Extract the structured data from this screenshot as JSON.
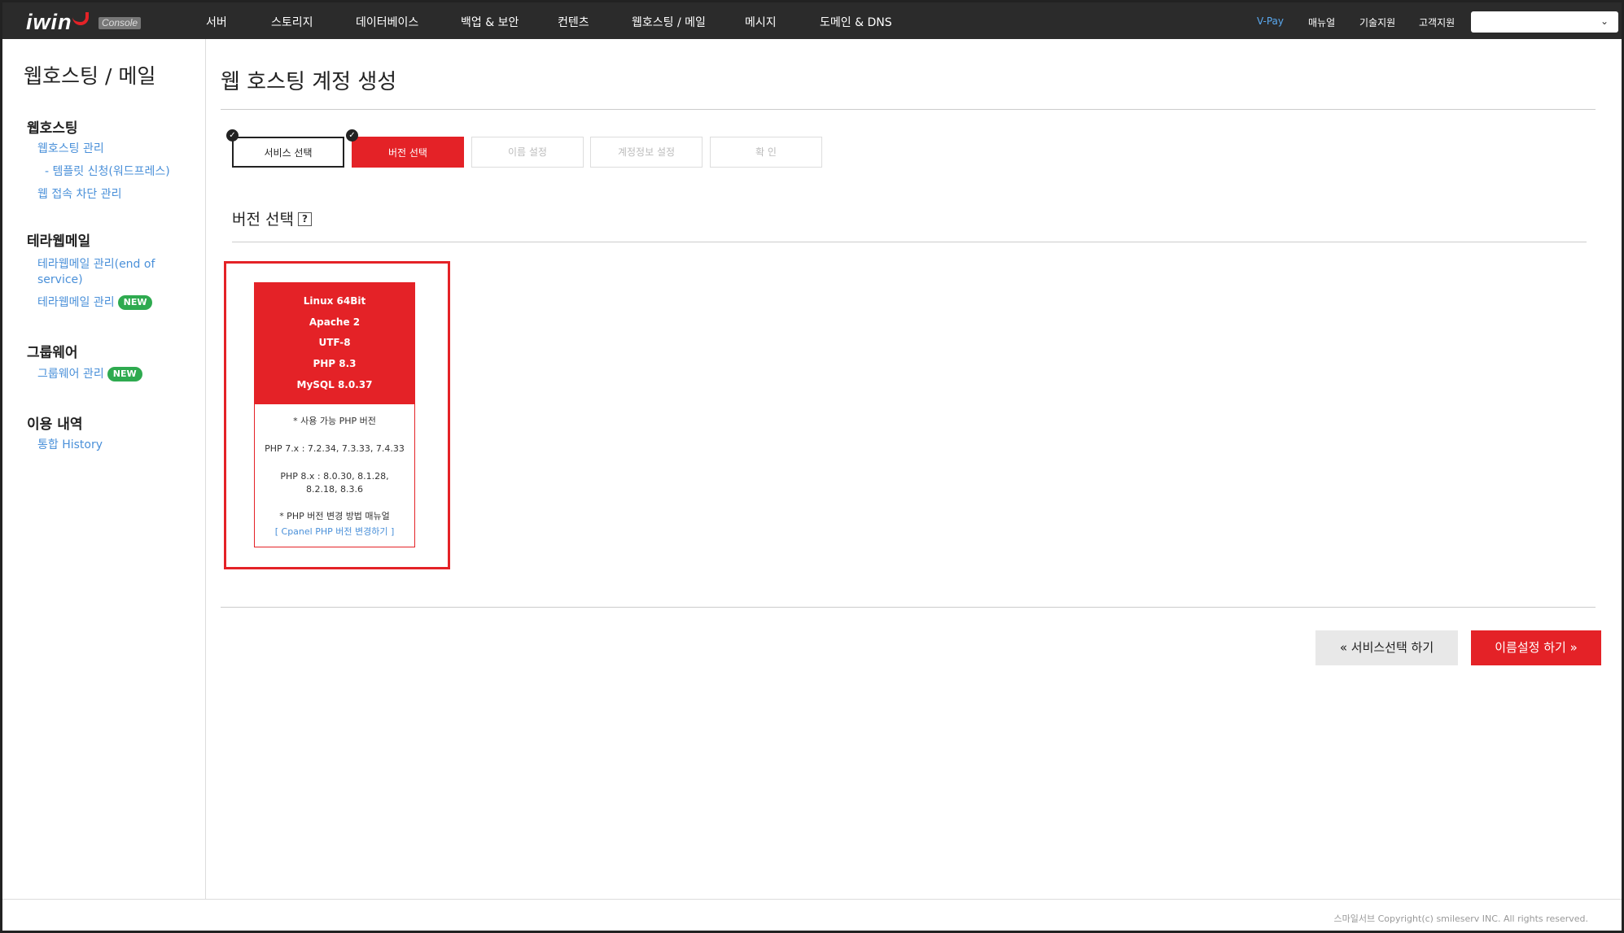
{
  "topbar": {
    "logo": "iwin",
    "console_badge": "Console",
    "nav": [
      "서버",
      "스토리지",
      "데이터베이스",
      "백업 & 보안",
      "컨텐츠",
      "웹호스팅 / 메일",
      "메시지",
      "도메인 & DNS"
    ],
    "util": [
      "V-Pay",
      "매뉴얼",
      "기술지원",
      "고객지원"
    ],
    "select_value": "",
    "chevron_icon": "chevron-down-icon"
  },
  "sidebar": {
    "title": "웹호스팅 / 메일",
    "sections": [
      {
        "heading": "웹호스팅",
        "links": [
          "웹호스팅 관리",
          "- 템플릿 신청(워드프레스)",
          "웹 접속 차단 관리"
        ]
      },
      {
        "heading": "테라웹메일",
        "links": [
          "테라웹메일 관리(end of",
          "service)",
          "테라웹메일 관리"
        ]
      },
      {
        "heading": "그룹웨어",
        "links": [
          "그룹웨어 관리"
        ]
      },
      {
        "heading": "이용 내역",
        "links": [
          "통합 History"
        ]
      }
    ],
    "badge_new": "NEW"
  },
  "main": {
    "page_title": "웹 호스팅 계정 생성",
    "steps": [
      "서비스 선택",
      "버전 선택",
      "이름 설정",
      "계정정보 설정",
      "확  인"
    ],
    "step_colors": {
      "active": "#e42227",
      "done": "#222222",
      "todo": "#bbbbbb"
    },
    "section_title": "버전 선택",
    "help": "?",
    "card": {
      "specs": [
        "Linux 64Bit",
        "Apache 2",
        "UTF-8",
        "PHP 8.3",
        "MySQL 8.0.37"
      ],
      "available_label": "* 사용 가능 PHP 버전",
      "php7": "PHP 7.x : 7.2.34, 7.3.33, 7.4.33",
      "php8_line1": "PHP 8.x : 8.0.30, 8.1.28,",
      "php8_line2": "8.2.18, 8.3.6",
      "manual_label": "* PHP 버전 변경 방법 매뉴얼",
      "manual_link": "[ Cpanel PHP 버전 변경하기 ]"
    },
    "btn_prev": "« 서비스선택 하기",
    "btn_next": "이름설정 하기 »"
  },
  "footer": {
    "copyright": "스마일서브 Copyright(c) smileserv INC. All rights reserved."
  }
}
